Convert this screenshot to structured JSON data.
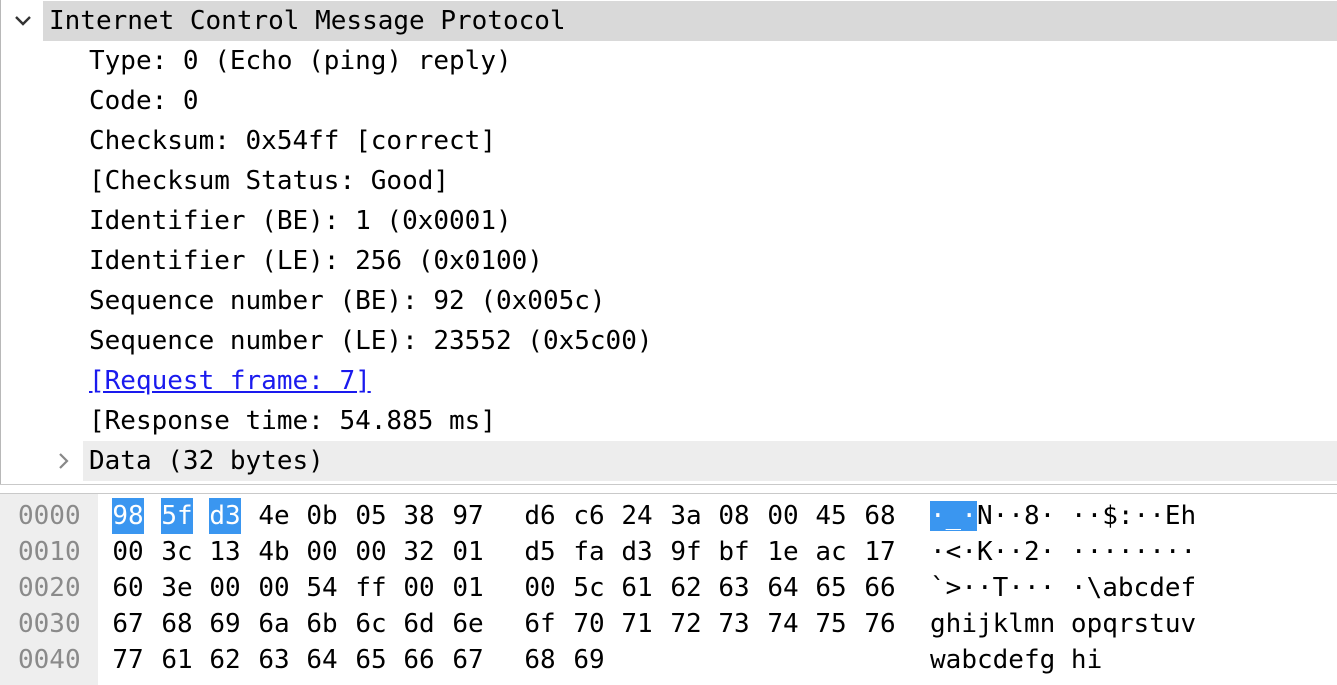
{
  "tree": {
    "header": {
      "label": "Internet Control Message Protocol",
      "expanded": true,
      "expander_icon": "chevron-down-icon"
    },
    "fields": [
      {
        "label": "Type: 0 (Echo (ping) reply)",
        "is_link": false
      },
      {
        "label": "Code: 0",
        "is_link": false
      },
      {
        "label": "Checksum: 0x54ff [correct]",
        "is_link": false
      },
      {
        "label": "[Checksum Status: Good]",
        "is_link": false
      },
      {
        "label": "Identifier (BE): 1 (0x0001)",
        "is_link": false
      },
      {
        "label": "Identifier (LE): 256 (0x0100)",
        "is_link": false
      },
      {
        "label": "Sequence number (BE): 92 (0x005c)",
        "is_link": false
      },
      {
        "label": "Sequence number (LE): 23552 (0x5c00)",
        "is_link": false
      },
      {
        "label": "[Request frame: 7]",
        "is_link": true
      },
      {
        "label": "[Response time: 54.885 ms]",
        "is_link": false
      }
    ],
    "data_node": {
      "label": "Data (32 bytes)",
      "expanded": false,
      "expander_icon": "chevron-right-icon"
    }
  },
  "bytes": {
    "lines": [
      {
        "offset": "0000",
        "hex": [
          "98",
          "5f",
          "d3",
          "4e",
          "0b",
          "05",
          "38",
          "97",
          "d6",
          "c6",
          "24",
          "3a",
          "08",
          "00",
          "45",
          "68"
        ],
        "ascii": [
          "·",
          "_",
          "·",
          "N",
          "·",
          "·",
          "8",
          "·",
          " ",
          "·",
          "·",
          "$",
          ":",
          "·",
          "·",
          "E",
          "h"
        ]
      },
      {
        "offset": "0010",
        "hex": [
          "00",
          "3c",
          "13",
          "4b",
          "00",
          "00",
          "32",
          "01",
          "d5",
          "fa",
          "d3",
          "9f",
          "bf",
          "1e",
          "ac",
          "17"
        ],
        "ascii": [
          "·",
          "<",
          "·",
          "K",
          "·",
          "·",
          "2",
          "·",
          " ",
          "·",
          "·",
          "·",
          "·",
          "·",
          "·",
          "·",
          "·"
        ]
      },
      {
        "offset": "0020",
        "hex": [
          "60",
          "3e",
          "00",
          "00",
          "54",
          "ff",
          "00",
          "01",
          "00",
          "5c",
          "61",
          "62",
          "63",
          "64",
          "65",
          "66"
        ],
        "ascii": [
          "`",
          ">",
          "·",
          "·",
          "T",
          "·",
          "·",
          "·",
          " ",
          "·",
          "\\",
          "a",
          "b",
          "c",
          "d",
          "e",
          "f"
        ]
      },
      {
        "offset": "0030",
        "hex": [
          "67",
          "68",
          "69",
          "6a",
          "6b",
          "6c",
          "6d",
          "6e",
          "6f",
          "70",
          "71",
          "72",
          "73",
          "74",
          "75",
          "76"
        ],
        "ascii": [
          "g",
          "h",
          "i",
          "j",
          "k",
          "l",
          "m",
          "n",
          " ",
          "o",
          "p",
          "q",
          "r",
          "s",
          "t",
          "u",
          "v"
        ]
      },
      {
        "offset": "0040",
        "hex": [
          "77",
          "61",
          "62",
          "63",
          "64",
          "65",
          "66",
          "67",
          "68",
          "69"
        ],
        "ascii": [
          "w",
          "a",
          "b",
          "c",
          "d",
          "e",
          "f",
          "g",
          " ",
          "h",
          "i"
        ]
      }
    ],
    "selection": {
      "line": 0,
      "start": 0,
      "end": 2
    },
    "colors": {
      "selection": "#3a96f0",
      "header_selected": "#d9d9d9",
      "link": "#1a1aee",
      "offset_text": "#8a8a8a"
    }
  }
}
